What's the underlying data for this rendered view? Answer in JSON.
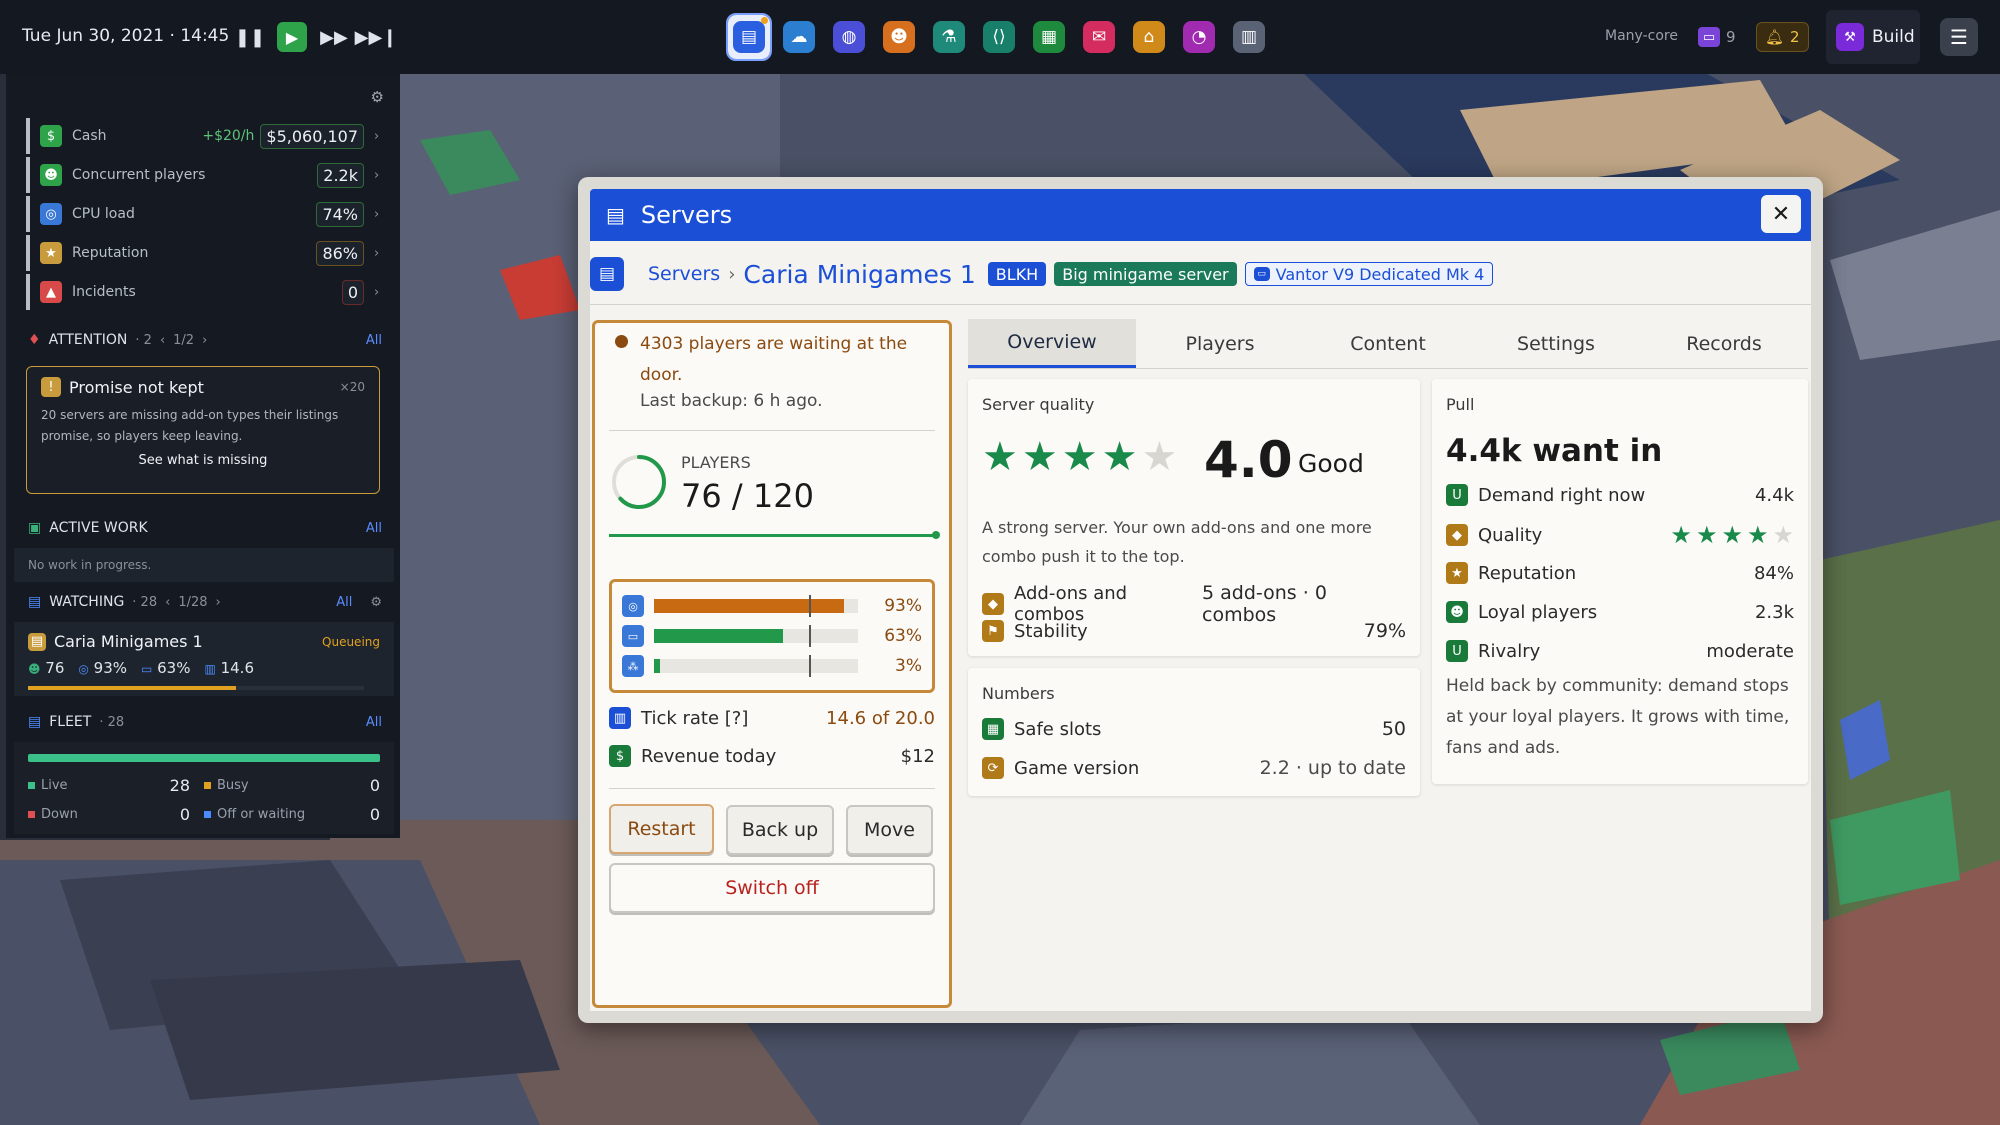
{
  "topbar": {
    "datetime": "Tue Jun 30, 2021 · 14:45",
    "mode": "Many-core",
    "cores_count": "9",
    "alerts_count": "2",
    "build_label": "Build"
  },
  "stats": [
    {
      "label": "Cash",
      "delta": "+$20/h",
      "value": "$5,060,107",
      "color": "#2fa34a",
      "icon": "cash-icon"
    },
    {
      "label": "Concurrent players",
      "delta": "",
      "value": "2.2k",
      "color": "#2fa34a",
      "icon": "players-icon"
    },
    {
      "label": "CPU load",
      "delta": "",
      "value": "74%",
      "color": "#3a78d8",
      "icon": "cpu-icon"
    },
    {
      "label": "Reputation",
      "delta": "",
      "value": "86%",
      "color": "#c89b3c",
      "icon": "reputation-icon"
    },
    {
      "label": "Incidents",
      "delta": "",
      "value": "0",
      "color": "#d84a4a",
      "icon": "incidents-icon"
    }
  ],
  "attention": {
    "title": "ATTENTION",
    "count": "· 2",
    "pager": "1/2",
    "all": "All"
  },
  "promise": {
    "title": "Promise not kept",
    "count": "×20",
    "body": "20 servers are missing add-on types their listings promise, so players keep leaving.",
    "link": "See what is missing"
  },
  "active_work": {
    "title": "ACTIVE WORK",
    "all": "All",
    "empty": "No work in progress."
  },
  "watching": {
    "title": "WATCHING",
    "count": "· 28",
    "pager": "1/28",
    "all": "All",
    "item": {
      "name": "Caria Minigames 1",
      "status": "Queueing",
      "players": "76",
      "cpu": "93%",
      "mem": "63%",
      "tick": "14.6",
      "progress": 0.62
    }
  },
  "fleet": {
    "title": "FLEET",
    "count": "· 28",
    "all": "All",
    "live_label": "Live",
    "live": "28",
    "busy_label": "Busy",
    "busy": "0",
    "down_label": "Down",
    "down": "0",
    "off_label": "Off or waiting",
    "off": "0"
  },
  "window": {
    "title": "Servers",
    "close": "✕",
    "crumb_root": "Servers",
    "crumb_sep": "›",
    "server_name": "Caria Minigames 1",
    "tag_region": "BLKH",
    "tag_type": "Big minigame server",
    "tag_hardware": "Vantor V9 Dedicated Mk 4"
  },
  "status": {
    "waiting": "4303 players are waiting at the door.",
    "backup": "Last backup: 6 h ago."
  },
  "players": {
    "label": "PLAYERS",
    "value": "76 / 120",
    "fill": 0.633
  },
  "meters": [
    {
      "name": "cpu",
      "value": 0.93,
      "label": "93%",
      "color": "#c86a12"
    },
    {
      "name": "memory",
      "value": 0.63,
      "label": "63%",
      "color": "#22994a"
    },
    {
      "name": "network",
      "value": 0.03,
      "label": "3%",
      "color": "#22994a"
    }
  ],
  "tick": {
    "label": "Tick rate [?]",
    "value": "14.6 of 20.0"
  },
  "revenue": {
    "label": "Revenue today",
    "value": "$12"
  },
  "buttons": {
    "restart": "Restart",
    "backup": "Back up",
    "move": "Move",
    "switch_off": "Switch off"
  },
  "tabs": [
    "Overview",
    "Players",
    "Content",
    "Settings",
    "Records"
  ],
  "quality": {
    "title": "Server quality",
    "rating": 4,
    "score": "4.0",
    "verdict": "Good",
    "desc": "A strong server. Your own add-ons and one more combo push it to the top.",
    "addons_label": "Add-ons and combos",
    "addons_value": "5 add-ons · 0 combos",
    "stability_label": "Stability",
    "stability_value": "79%"
  },
  "numbers": {
    "title": "Numbers",
    "slots_label": "Safe slots",
    "slots_value": "50",
    "version_label": "Game version",
    "version_value": "2.2 · up to date"
  },
  "pull": {
    "title": "Pull",
    "headline": "4.4k want in",
    "demand_label": "Demand right now",
    "demand_value": "4.4k",
    "quality_label": "Quality",
    "quality_stars": 4,
    "reputation_label": "Reputation",
    "reputation_value": "84%",
    "loyal_label": "Loyal players",
    "loyal_value": "2.3k",
    "rivalry_label": "Rivalry",
    "rivalry_value": "moderate",
    "note": "Held back by community: demand stops at your loyal players. It grows with time, fans and ads."
  },
  "colors": {
    "accent": "#1a4fd6",
    "good": "#22994a",
    "warn": "#c6893a",
    "danger": "#b8221e"
  }
}
